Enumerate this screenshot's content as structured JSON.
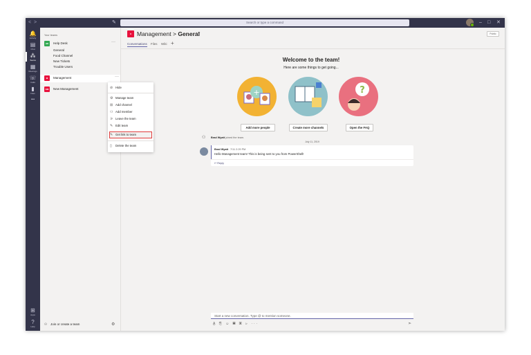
{
  "titlebar": {
    "back": "<",
    "forward": ">",
    "compose_icon": "compose-icon",
    "search_placeholder": "Search or type a command",
    "minimize": "–",
    "maximize": "□",
    "close": "✕"
  },
  "appbar": {
    "items": [
      {
        "label": "Activity",
        "icon": "bell-icon",
        "glyph": "🔔"
      },
      {
        "label": "Chat",
        "icon": "chat-icon",
        "glyph": "▤"
      },
      {
        "label": "Teams",
        "icon": "teams-icon",
        "glyph": "⁂"
      },
      {
        "label": "Meetings",
        "icon": "calendar-icon",
        "glyph": "▦"
      },
      {
        "label": "Calls",
        "icon": "phone-icon",
        "glyph": "☏"
      },
      {
        "label": "Files",
        "icon": "files-icon",
        "glyph": "▮"
      },
      {
        "label": "",
        "icon": "more-icon",
        "glyph": "•••"
      }
    ],
    "bottom": [
      {
        "label": "Apps",
        "icon": "apps-icon",
        "glyph": "⊞"
      },
      {
        "label": "Help",
        "icon": "help-icon",
        "glyph": "?"
      }
    ]
  },
  "teams_panel": {
    "section_label": "Your teams",
    "teams": [
      {
        "name": "Help Desk",
        "tile_color": "#33a852",
        "tile_text": "HD",
        "more": "···"
      },
      {
        "name": "Management",
        "tile_color": "#e8123d",
        "tile_text": "M",
        "more": "···"
      },
      {
        "name": "New Management",
        "tile_color": "#e8123d",
        "tile_text": "NM",
        "more": ""
      }
    ],
    "channels": [
      "General",
      "Food Channel",
      "New Tickets",
      "Trouble Users"
    ],
    "join_label": "Join or create a team"
  },
  "context_menu": {
    "items": [
      {
        "label": "Hide",
        "icon": "hide-icon",
        "glyph": "⊘"
      },
      {
        "label": "Manage team",
        "icon": "settings-icon",
        "glyph": "⚙"
      },
      {
        "label": "Add channel",
        "icon": "add-channel-icon",
        "glyph": "⊞"
      },
      {
        "label": "Add member",
        "icon": "add-member-icon",
        "glyph": "⚇"
      },
      {
        "label": "Leave the team",
        "icon": "leave-icon",
        "glyph": "⚞"
      },
      {
        "label": "Edit team",
        "icon": "pencil-icon",
        "glyph": "✎"
      },
      {
        "label": "Get link to team",
        "icon": "link-icon",
        "glyph": "🔗"
      },
      {
        "label": "Delete the team",
        "icon": "trash-icon",
        "glyph": "🗑"
      }
    ]
  },
  "header": {
    "team": "Management",
    "separator": ">",
    "channel": "General",
    "more": "···",
    "visibility": "Public",
    "tile_text": "M",
    "tabs": [
      "Conversations",
      "Files",
      "Wiki"
    ],
    "add_tab": "+"
  },
  "welcome": {
    "title": "Welcome to the team!",
    "subtitle": "Here are some things to get going...",
    "buttons": [
      "Add more people",
      "Create more channels",
      "Open the FAQ"
    ],
    "circle_colors": [
      "#f2b233",
      "#8fc1c9",
      "#e9707f"
    ]
  },
  "activity": {
    "joined_user": "Brad Wyatt",
    "joined_text": "joined the team.",
    "date": "July 11, 2019",
    "post": {
      "author": "Brad Wyatt",
      "time": "7/11 2:29 PM",
      "text": "Hello Management team! This is being sent to you from PowerShell!",
      "reply": "↩ Reply"
    }
  },
  "compose": {
    "placeholder": "Start a new conversation. Type @ to mention someone.",
    "tools": "A̲ ⎘ ☺ ▦ ▣ ⊳ ···",
    "send": "➣"
  }
}
